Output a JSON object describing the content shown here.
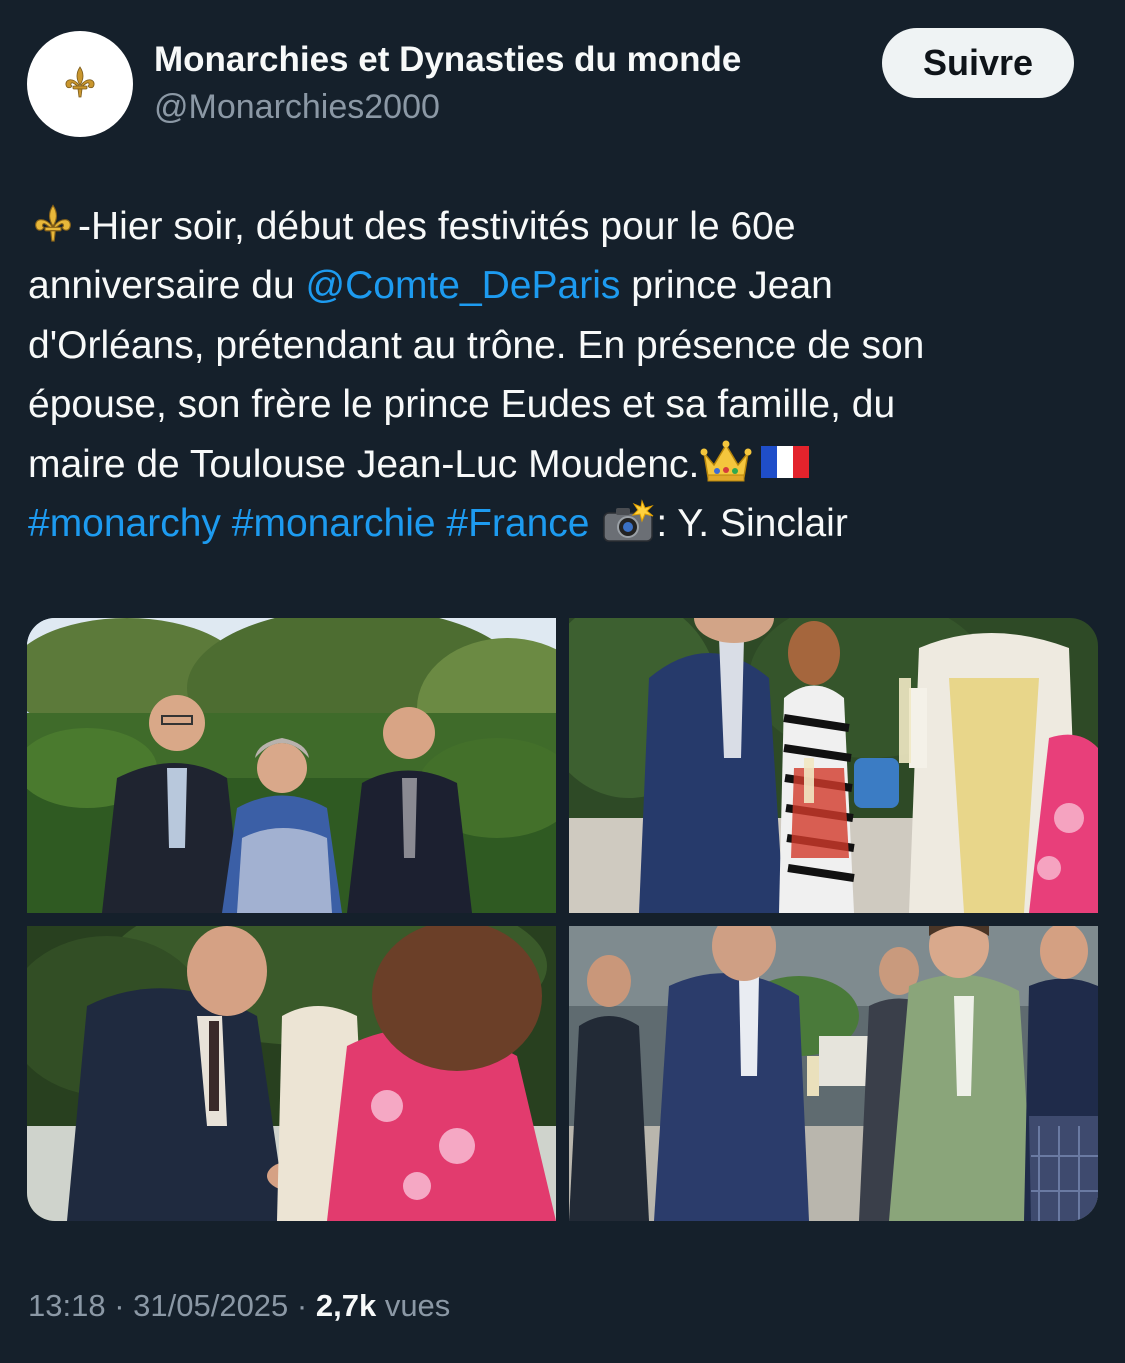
{
  "account": {
    "display_name": "Monarchies et Dynasties du monde",
    "handle": "@Monarchies2000",
    "avatar_icon": "fleur-de-lis-icon"
  },
  "follow_button": {
    "label": "Suivre"
  },
  "tweet": {
    "seg1": "-Hier soir, début des festivités pour le 60e",
    "seg2": "anniversaire du ",
    "mention": "@Comte_DeParis",
    "seg3": "  prince Jean",
    "seg4": "d'Orléans, prétendant au trône. En présence de son",
    "seg5": "épouse,  son frère le  prince Eudes et sa famille, du",
    "seg6": "maire de Toulouse Jean-Luc Moudenc.",
    "hashtags": [
      "#monarchy",
      "#monarchie",
      "#France"
    ],
    "credit": ": Y. Sinclair",
    "emojis": [
      "fleur-de-lis-icon",
      "crown-icon",
      "france-flag-icon",
      "camera-flash-icon"
    ]
  },
  "media": {
    "count": 4
  },
  "meta": {
    "time": "13:18",
    "separator": " · ",
    "date": "31/05/2025",
    "views_count": "2,7k",
    "views_label": " vues"
  },
  "colors": {
    "background": "#15202b",
    "text": "#f7f9f9",
    "secondary": "#8b98a5",
    "link": "#1d9bf0",
    "button_bg": "#eff3f4"
  }
}
